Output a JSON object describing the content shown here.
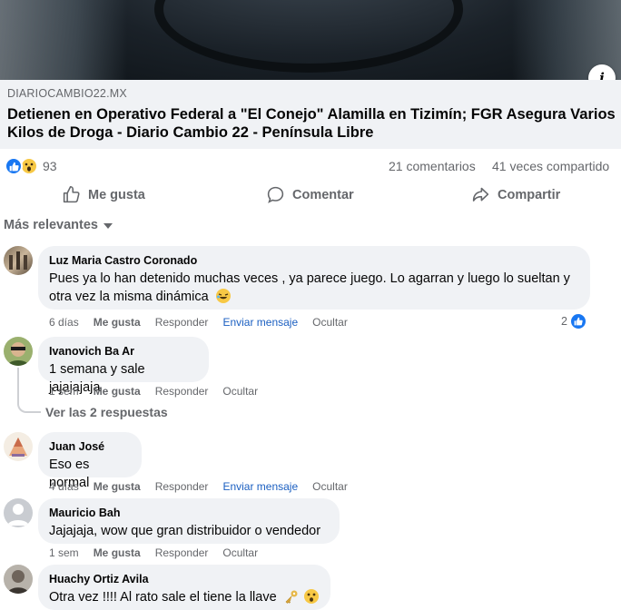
{
  "colors": {
    "accent": "#1877f2",
    "link_blue": "#1b5fc1",
    "muted": "#65676b",
    "bubble": "#f0f2f5"
  },
  "post": {
    "link_domain": "DIARIOCAMBIO22.MX",
    "link_title": "Detienen en Operativo Federal a \"El Conejo\" Alamilla en Tizimín; FGR Asegura Varios Kilos de Droga - Diario Cambio 22 - Península Libre",
    "reaction_count": "93",
    "comments_count": "21 comentarios",
    "shares_count": "41 veces compartido"
  },
  "actions": {
    "like": "Me gusta",
    "comment": "Comentar",
    "share": "Compartir"
  },
  "sort_label": "Más relevantes",
  "comments": [
    {
      "name": "Luz Maria Castro Coronado",
      "text_line1": "Pues ya lo han detenido muchas veces , ya parece juego. Lo agarran y luego lo sueltan y",
      "text_line2": "otra vez la misma dinámica",
      "time": "6 días",
      "like": "Me gusta",
      "reply": "Responder",
      "send": "Enviar mensaje",
      "hide": "Ocultar",
      "likes": "2"
    },
    {
      "name": "Ivanovich Ba Ar",
      "text": "1 semana y sale jajajajaja",
      "time": "1 sem",
      "like": "Me gusta",
      "reply": "Responder",
      "hide": "Ocultar"
    },
    {
      "name": "Juan José",
      "text": "Eso es normal",
      "time": "4 días",
      "like": "Me gusta",
      "reply": "Responder",
      "send": "Enviar mensaje",
      "hide": "Ocultar"
    },
    {
      "name": "Mauricio Bah",
      "text": "Jajajaja, wow que gran distribuidor o vendedor",
      "time": "1 sem",
      "like": "Me gusta",
      "reply": "Responder",
      "hide": "Ocultar"
    },
    {
      "name": "Huachy Ortiz Avila",
      "text": "Otra vez !!!! Al rato sale el tiene la llave"
    }
  ],
  "view_replies": "Ver las 2 respuestas"
}
